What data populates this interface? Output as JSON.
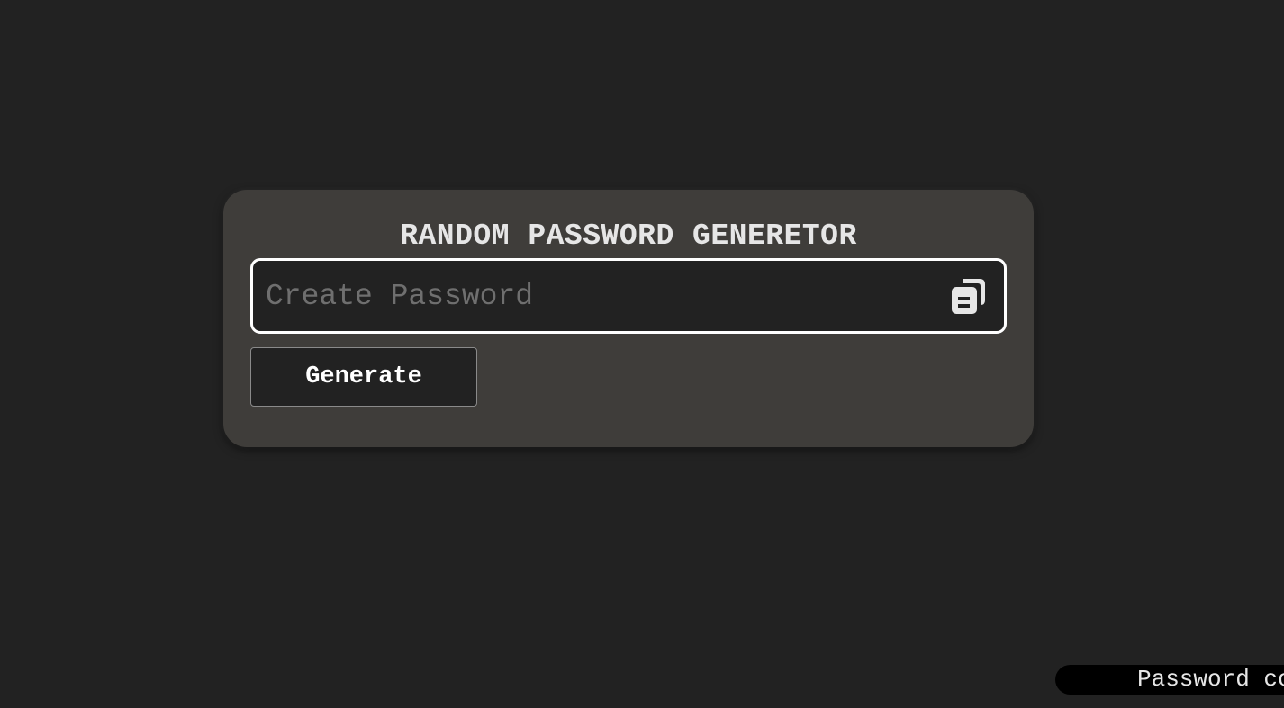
{
  "app": {
    "title": "RANDOM PASSWORD GENERETOR"
  },
  "password_field": {
    "value": "",
    "placeholder": "Create Password"
  },
  "copy_button": {
    "icon": "copy-icon",
    "icon_color": "#e6e6e6"
  },
  "generate_button": {
    "label": "Generate"
  },
  "toast": {
    "text": "Password copied"
  },
  "colors": {
    "page_background": "#222222",
    "card_background": "#3f3d3a",
    "field_border": "#ffffff",
    "toast_background": "#000000"
  }
}
